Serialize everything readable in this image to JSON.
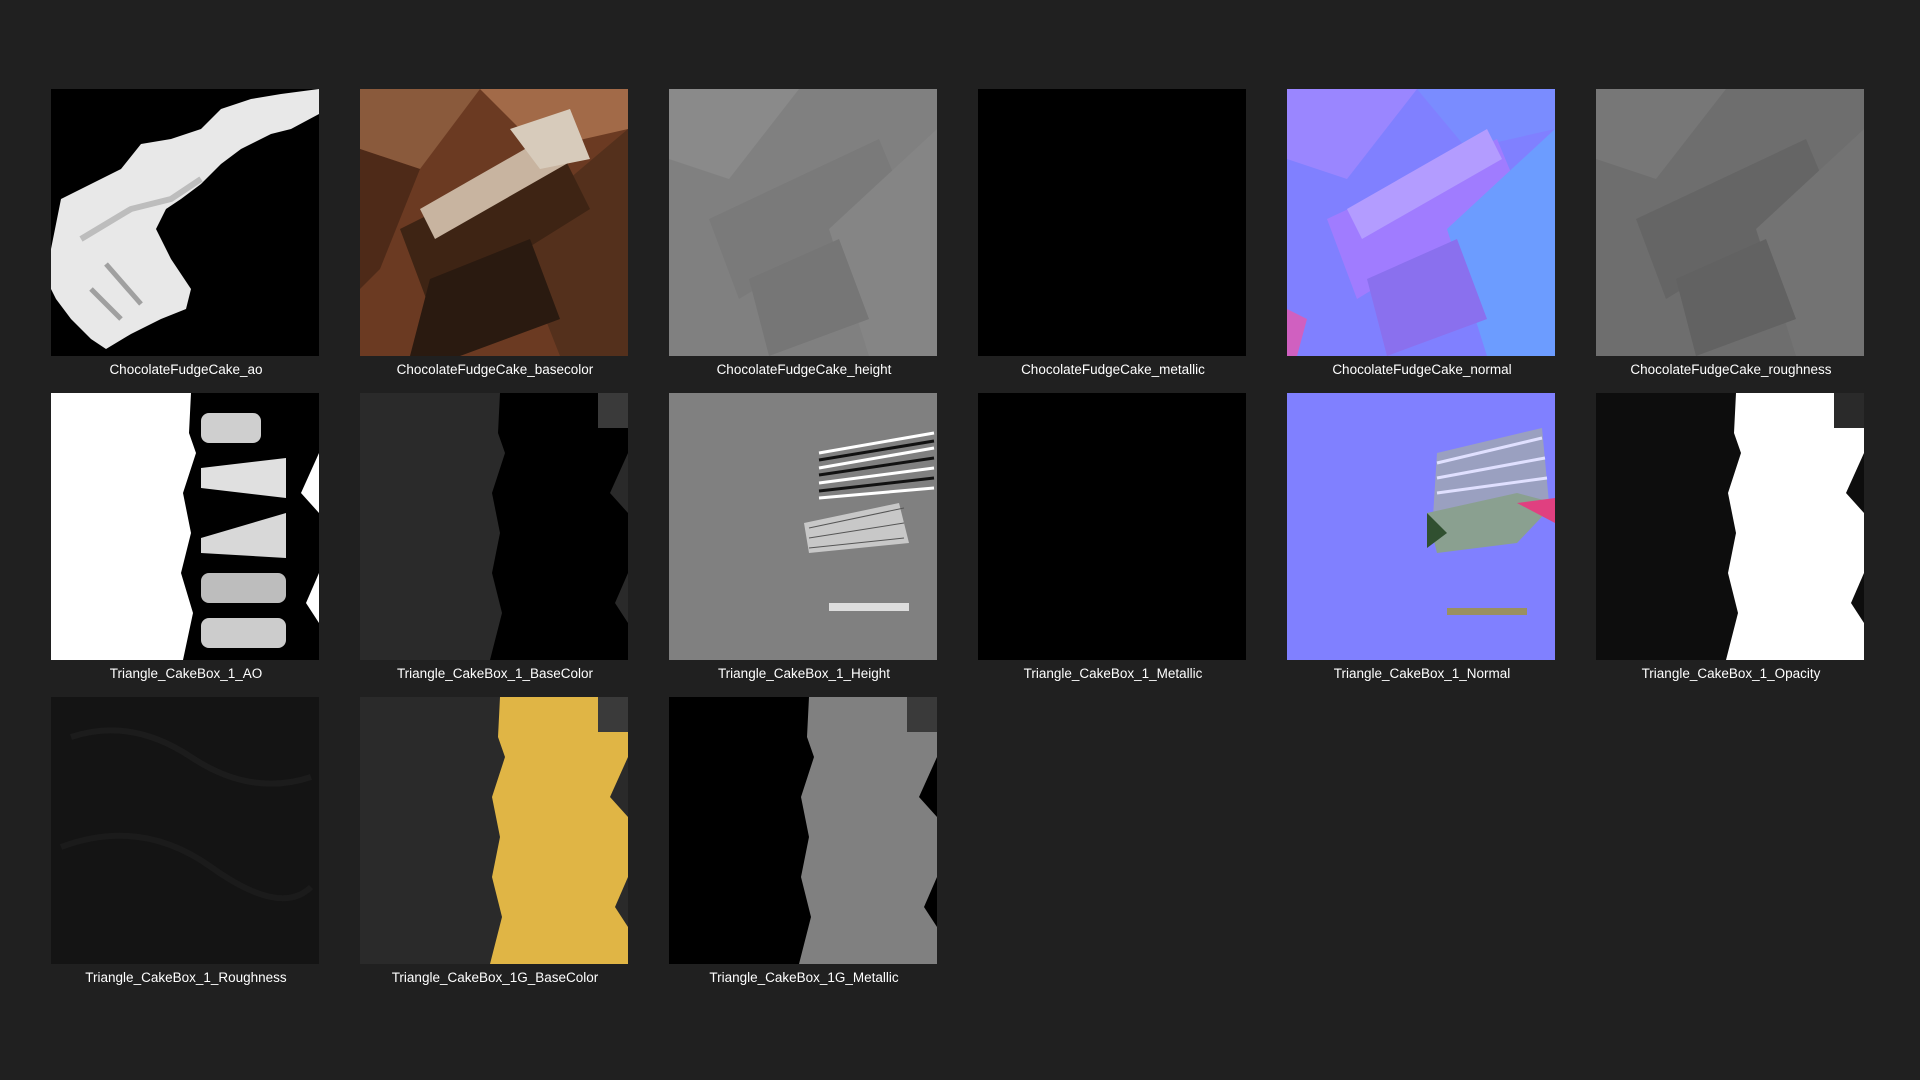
{
  "files": [
    {
      "name": "ChocolateFudgeCake_ao",
      "thumbnail": "ao-cake-icon"
    },
    {
      "name": "ChocolateFudgeCake_basecolor",
      "thumbnail": "basecolor-cake-icon"
    },
    {
      "name": "ChocolateFudgeCake_height",
      "thumbnail": "height-cake-icon"
    },
    {
      "name": "ChocolateFudgeCake_metallic",
      "thumbnail": "metallic-cake-icon"
    },
    {
      "name": "ChocolateFudgeCake_normal",
      "thumbnail": "normal-cake-icon"
    },
    {
      "name": "ChocolateFudgeCake_roughness",
      "thumbnail": "roughness-cake-icon"
    },
    {
      "name": "Triangle_CakeBox_1_AO",
      "thumbnail": "ao-box-icon"
    },
    {
      "name": "Triangle_CakeBox_1_BaseColor",
      "thumbnail": "basecolor-box-icon"
    },
    {
      "name": "Triangle_CakeBox_1_Height",
      "thumbnail": "height-box-icon"
    },
    {
      "name": "Triangle_CakeBox_1_Metallic",
      "thumbnail": "metallic-box-icon"
    },
    {
      "name": "Triangle_CakeBox_1_Normal",
      "thumbnail": "normal-box-icon"
    },
    {
      "name": "Triangle_CakeBox_1_Opacity",
      "thumbnail": "opacity-box-icon"
    },
    {
      "name": "Triangle_CakeBox_1_Roughness",
      "thumbnail": "roughness-box-icon"
    },
    {
      "name": "Triangle_CakeBox_1G_BaseColor",
      "thumbnail": "basecolor-box-1g-icon"
    },
    {
      "name": "Triangle_CakeBox_1G_Metallic",
      "thumbnail": "metallic-box-1g-icon"
    }
  ],
  "colors": {
    "background": "#202020",
    "caption": "#ffffff",
    "normal_map": "#8080ff",
    "box_yellow": "#e0b545"
  }
}
